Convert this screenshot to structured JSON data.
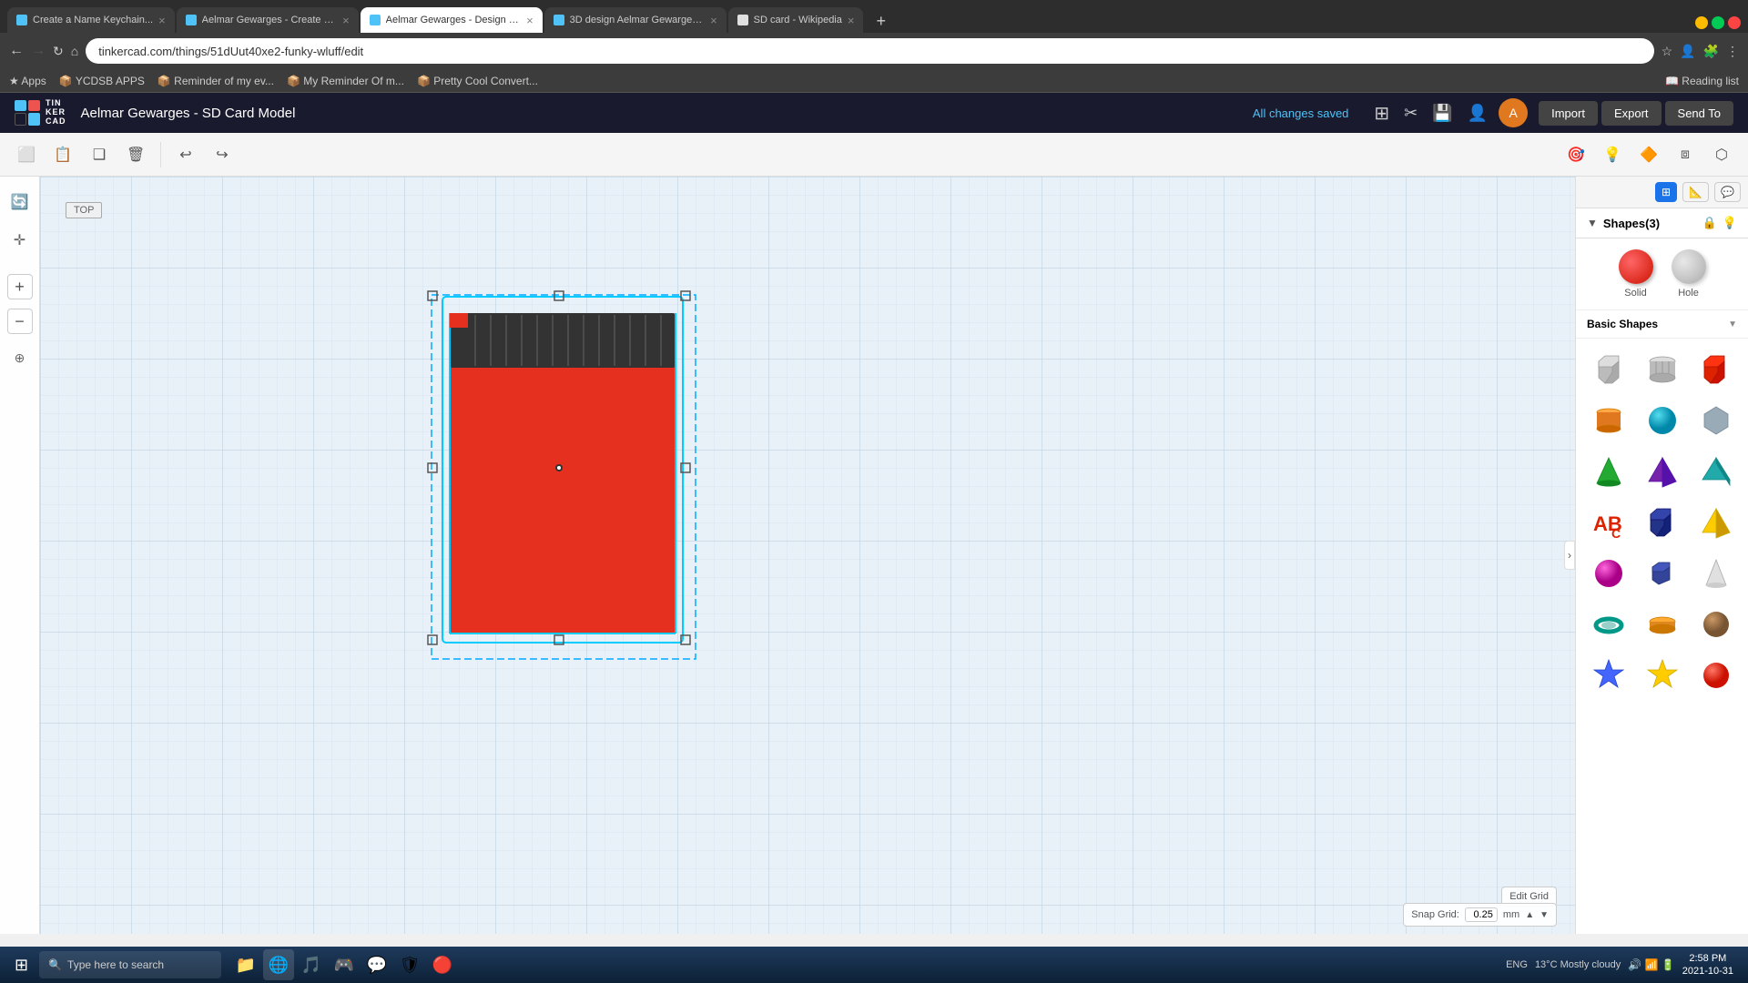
{
  "browser": {
    "tabs": [
      {
        "id": "tab1",
        "title": "Create a Name Keychain...",
        "favicon_color": "#4fc3f7",
        "active": false
      },
      {
        "id": "tab2",
        "title": "Aelmar Gewarges - Create a Na...",
        "favicon_color": "#4fc3f7",
        "active": false
      },
      {
        "id": "tab3",
        "title": "Aelmar Gewarges - Design & M...",
        "favicon_color": "#4fc3f7",
        "active": true
      },
      {
        "id": "tab4",
        "title": "3D design Aelmar Gewarges - S...",
        "favicon_color": "#4fc3f7",
        "active": false
      },
      {
        "id": "tab5",
        "title": "SD card - Wikipedia",
        "favicon_color": "#e0e0e0",
        "active": false
      }
    ],
    "address": "tinkercad.com/things/51dUut40xe2-funky-wluff/edit",
    "bookmarks": [
      "Apps",
      "YCDSB APPS",
      "Reminder of my ev...",
      "My Reminder Of m...",
      "Pretty Cool Convert..."
    ]
  },
  "app": {
    "title": "Aelmar Gewarges - SD Card Model",
    "status": "All changes saved",
    "header_btns": [
      "grid-view",
      "3d-view",
      "export",
      "profile"
    ],
    "import_label": "Import",
    "export_label": "Export",
    "send_to_label": "Send To"
  },
  "toolbar": {
    "tools": [
      "copy",
      "paste",
      "duplicate",
      "delete",
      "undo",
      "redo"
    ],
    "view_tools": [
      "camera",
      "light",
      "shape",
      "align",
      "mirror"
    ]
  },
  "canvas": {
    "view_label": "TOP",
    "snap_grid_label": "Snap Grid:",
    "snap_grid_value": "0.25",
    "snap_grid_unit": "mm",
    "edit_grid_label": "Edit Grid"
  },
  "shapes_panel": {
    "title": "Shapes(3)",
    "solid_label": "Solid",
    "hole_label": "Hole",
    "category": "Basic Shapes",
    "shapes": [
      {
        "name": "Box-gray",
        "color": "#aaa"
      },
      {
        "name": "Cylinder-striped",
        "color": "#bbb"
      },
      {
        "name": "Box-red",
        "color": "#cc2200"
      },
      {
        "name": "Cylinder-orange",
        "color": "#e07820"
      },
      {
        "name": "Sphere-teal",
        "color": "#00a8c6"
      },
      {
        "name": "Shape-metallic",
        "color": "#8899aa"
      },
      {
        "name": "Cone-green",
        "color": "#22aa33"
      },
      {
        "name": "Pyramid-purple",
        "color": "#7722aa"
      },
      {
        "name": "Prism-teal",
        "color": "#11aaaa"
      },
      {
        "name": "Text-red",
        "color": "#cc2200"
      },
      {
        "name": "Box-navy",
        "color": "#223388"
      },
      {
        "name": "Pyramid-yellow",
        "color": "#ffcc00"
      },
      {
        "name": "Sphere-magenta",
        "color": "#cc00aa"
      },
      {
        "name": "Box-blue",
        "color": "#334499"
      },
      {
        "name": "Cone-white",
        "color": "#e0e0e0"
      },
      {
        "name": "Torus-teal",
        "color": "#009988"
      },
      {
        "name": "Cylinder-flat",
        "color": "#cc7700"
      },
      {
        "name": "Sphere-brown",
        "color": "#996644"
      },
      {
        "name": "Star-blue",
        "color": "#4466ff"
      },
      {
        "name": "Star-yellow",
        "color": "#ffcc00"
      },
      {
        "name": "Sphere-red2",
        "color": "#cc2200"
      }
    ]
  },
  "taskbar": {
    "search_placeholder": "Type here to search",
    "temperature": "13°C",
    "weather": "Mostly cloudy",
    "time": "2:58 PM",
    "date": "2021-10-31",
    "language": "ENG"
  }
}
